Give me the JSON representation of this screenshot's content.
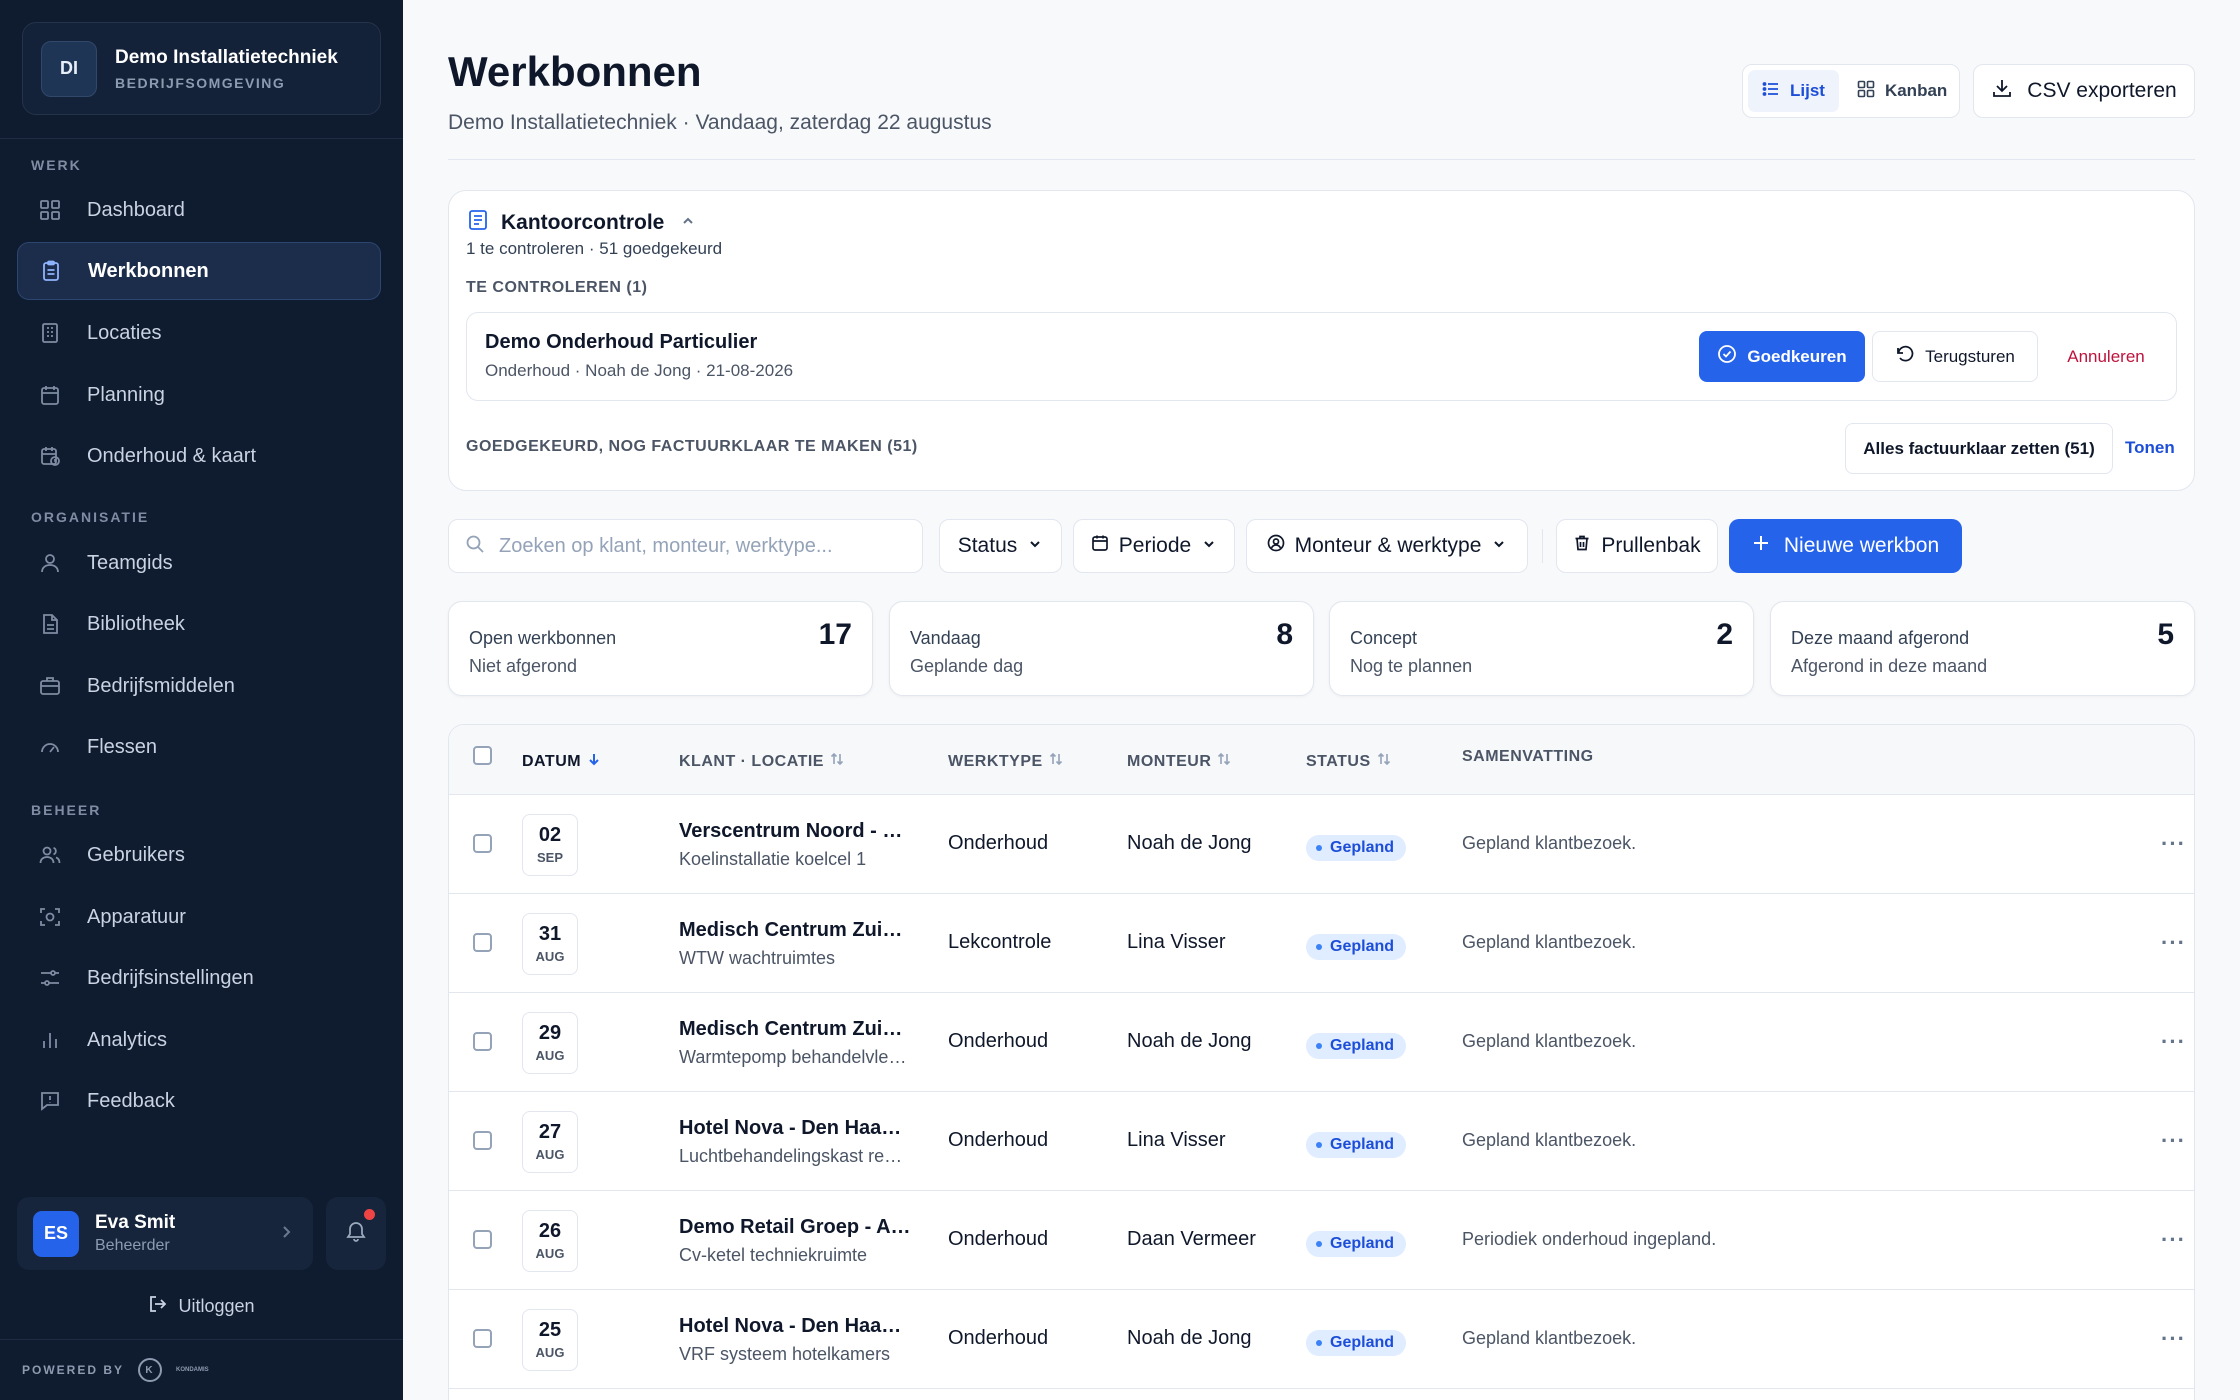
{
  "org": {
    "initials": "DI",
    "name": "Demo Installatietechniek",
    "env": "BEDRIJFSOMGEVING"
  },
  "sidebar": {
    "sections": [
      {
        "title": "WERK",
        "items": [
          {
            "label": "Dashboard",
            "icon": "grid-icon"
          },
          {
            "label": "Werkbonnen",
            "icon": "clipboard-icon",
            "active": true
          },
          {
            "label": "Locaties",
            "icon": "building-icon"
          },
          {
            "label": "Planning",
            "icon": "calendar-icon"
          },
          {
            "label": "Onderhoud & kaart",
            "icon": "calendar-clock-icon"
          }
        ]
      },
      {
        "title": "ORGANISATIE",
        "items": [
          {
            "label": "Teamgids",
            "icon": "user-icon"
          },
          {
            "label": "Bibliotheek",
            "icon": "document-icon"
          },
          {
            "label": "Bedrijfsmiddelen",
            "icon": "briefcase-icon"
          },
          {
            "label": "Flessen",
            "icon": "gauge-icon"
          }
        ]
      },
      {
        "title": "BEHEER",
        "items": [
          {
            "label": "Gebruikers",
            "icon": "users-icon"
          },
          {
            "label": "Apparatuur",
            "icon": "scan-icon"
          },
          {
            "label": "Bedrijfsinstellingen",
            "icon": "sliders-icon"
          },
          {
            "label": "Analytics",
            "icon": "bar-chart-icon"
          },
          {
            "label": "Feedback",
            "icon": "message-icon"
          }
        ]
      }
    ]
  },
  "user": {
    "initials": "ES",
    "name": "Eva Smit",
    "role": "Beheerder"
  },
  "logout_label": "Uitloggen",
  "powered_by": "POWERED BY",
  "powered_brand": "KONDAMIS",
  "header": {
    "title": "Werkbonnen",
    "subtitle": "Demo Installatietechniek · Vandaag, zaterdag 22 augustus",
    "view_list": "Lijst",
    "view_kanban": "Kanban",
    "csv_label": "CSV exporteren"
  },
  "review": {
    "title": "Kantoorcontrole",
    "counts": "1 te controleren · 51 goedgekeurd",
    "to_check_heading": "TE CONTROLEREN (1)",
    "item": {
      "title": "Demo Onderhoud Particulier",
      "meta": "Onderhoud · Noah de Jong · 21-08-2026"
    },
    "approve_label": "Goedkeuren",
    "return_label": "Terugsturen",
    "cancel_label": "Annuleren",
    "approved_heading": "GOEDGEKEURD, NOG FACTUURKLAAR TE MAKEN (51)",
    "all_label": "Alles factuurklaar zetten (51)",
    "show_label": "Tonen"
  },
  "filters": {
    "search_placeholder": "Zoeken op klant, monteur, werktype...",
    "status": "Status",
    "period": "Periode",
    "mechanic": "Monteur & werktype",
    "trash": "Prullenbak",
    "new": "Nieuwe werkbon"
  },
  "stats": [
    {
      "label": "Open werkbonnen",
      "sub": "Niet afgerond",
      "value": "17"
    },
    {
      "label": "Vandaag",
      "sub": "Geplande dag",
      "value": "8"
    },
    {
      "label": "Concept",
      "sub": "Nog te plannen",
      "value": "2"
    },
    {
      "label": "Deze maand afgerond",
      "sub": "Afgerond in deze maand",
      "value": "5"
    }
  ],
  "table": {
    "columns": {
      "date": "DATUM",
      "client": "KLANT · LOCATIE",
      "type": "WERKTYPE",
      "mechanic": "MONTEUR",
      "status": "STATUS",
      "summary": "SAMENVATTING"
    },
    "rows": [
      {
        "day": "02",
        "month": "SEP",
        "client": "Verscentrum Noord - Zwolle",
        "location": "Koelinstallatie koelcel 1",
        "type": "Onderhoud",
        "mechanic": "Noah de Jong",
        "status": "Gepland",
        "summary": "Gepland klantbezoek."
      },
      {
        "day": "31",
        "month": "AUG",
        "client": "Medisch Centrum Zuid - Breda",
        "location": "WTW wachtruimtes",
        "type": "Lekcontrole",
        "mechanic": "Lina Visser",
        "status": "Gepland",
        "summary": "Gepland klantbezoek."
      },
      {
        "day": "29",
        "month": "AUG",
        "client": "Medisch Centrum Zuid - Breda",
        "location": "Warmtepomp behandelvleugel",
        "type": "Onderhoud",
        "mechanic": "Noah de Jong",
        "status": "Gepland",
        "summary": "Gepland klantbezoek."
      },
      {
        "day": "27",
        "month": "AUG",
        "client": "Hotel Nova - Den Haag Centrum",
        "location": "Luchtbehandelingskast restaurant",
        "type": "Onderhoud",
        "mechanic": "Lina Visser",
        "status": "Gepland",
        "summary": "Gepland klantbezoek."
      },
      {
        "day": "26",
        "month": "AUG",
        "client": "Demo Retail Groep - Amersfoort",
        "location": "Cv-ketel techniekruimte",
        "type": "Onderhoud",
        "mechanic": "Daan Vermeer",
        "status": "Gepland",
        "summary": "Periodiek onderhoud ingepland."
      },
      {
        "day": "25",
        "month": "AUG",
        "client": "Hotel Nova - Den Haag Centrum",
        "location": "VRF systeem hotelkamers",
        "type": "Onderhoud",
        "mechanic": "Noah de Jong",
        "status": "Gepland",
        "summary": "Gepland klantbezoek."
      }
    ]
  },
  "colors": {
    "sidebar_bg": "#0f1b2e",
    "accent": "#2563eb",
    "danger": "#be123c",
    "badge_bg": "#e0ecff"
  }
}
